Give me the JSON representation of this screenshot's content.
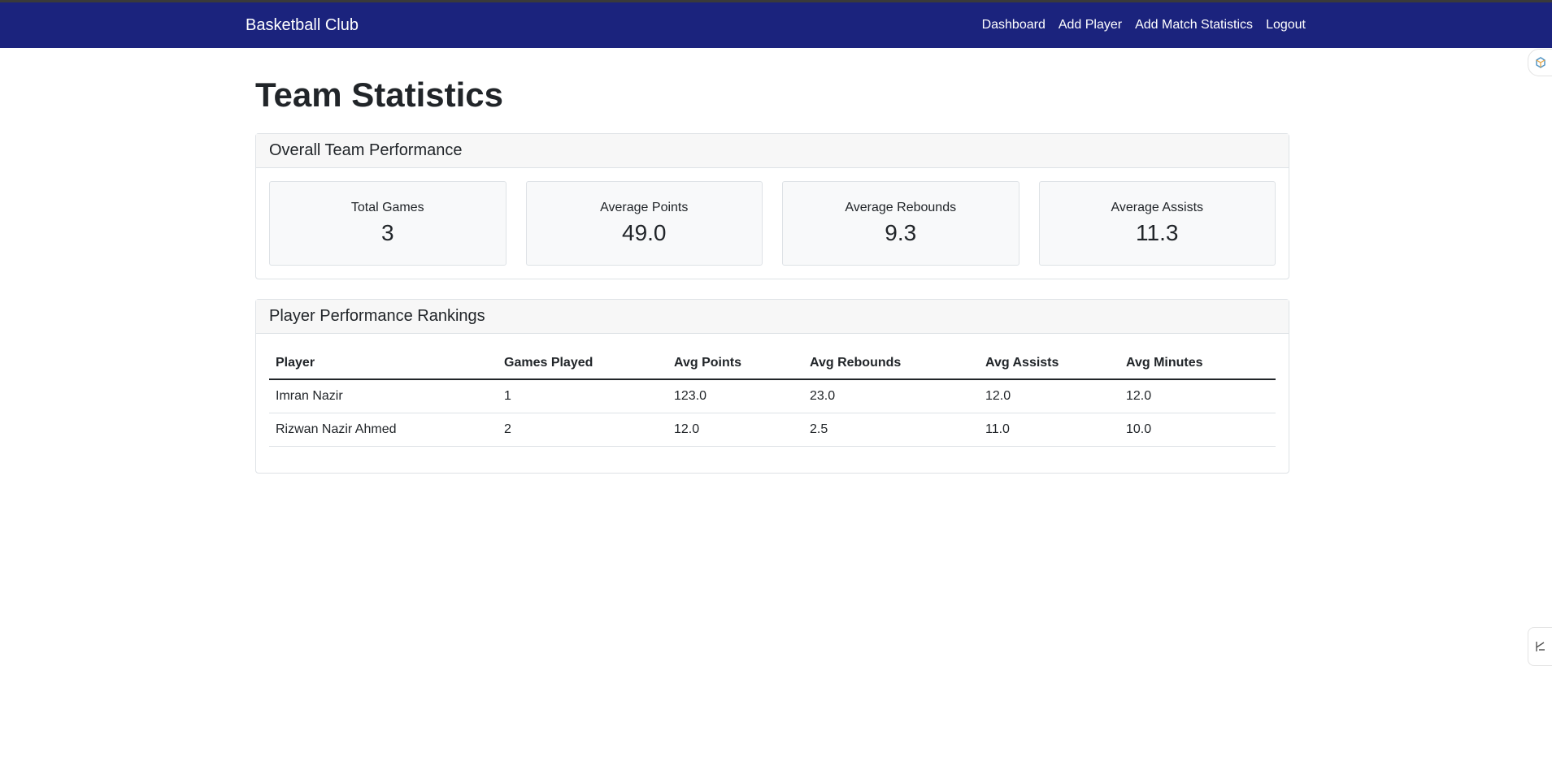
{
  "navbar": {
    "brand": "Basketball Club",
    "links": [
      "Dashboard",
      "Add Player",
      "Add Match Statistics",
      "Logout"
    ]
  },
  "page": {
    "title": "Team Statistics"
  },
  "overall": {
    "header": "Overall Team Performance",
    "stats": [
      {
        "label": "Total Games",
        "value": "3"
      },
      {
        "label": "Average Points",
        "value": "49.0"
      },
      {
        "label": "Average Rebounds",
        "value": "9.3"
      },
      {
        "label": "Average Assists",
        "value": "11.3"
      }
    ]
  },
  "rankings": {
    "header": "Player Performance Rankings",
    "columns": [
      "Player",
      "Games Played",
      "Avg Points",
      "Avg Rebounds",
      "Avg Assists",
      "Avg Minutes"
    ],
    "rows": [
      [
        "Imran Nazir",
        "1",
        "123.0",
        "23.0",
        "12.0",
        "12.0"
      ],
      [
        "Rizwan Nazir Ahmed",
        "2",
        "12.0",
        "2.5",
        "11.0",
        "10.0"
      ]
    ]
  },
  "icons": {
    "edge_top": "extension-icon",
    "edge_bottom": "sidebar-toggle-icon"
  },
  "colors": {
    "navbar": "#1b237d",
    "accent_icon": "#4a90c2"
  }
}
